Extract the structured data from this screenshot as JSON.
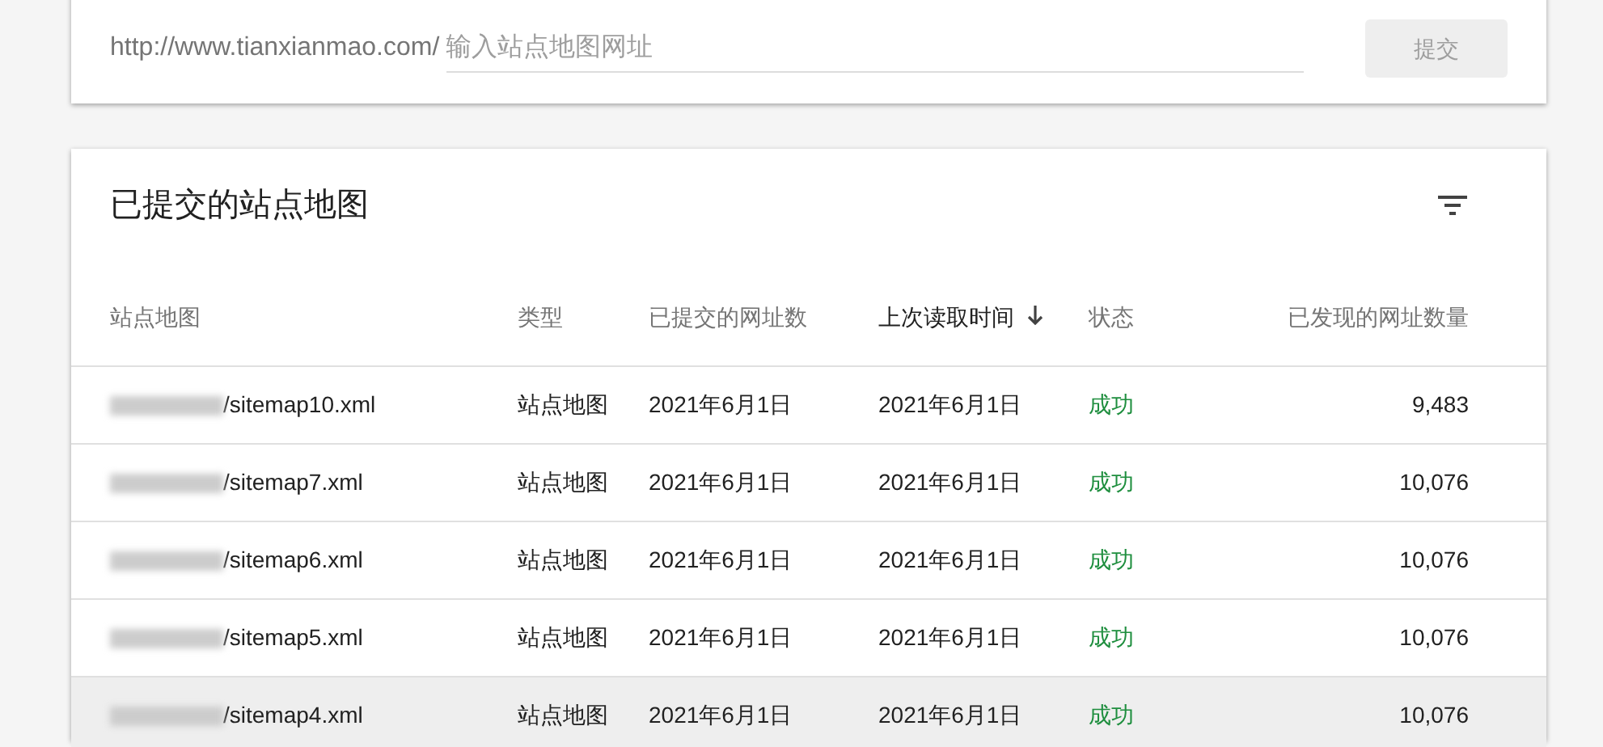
{
  "submit_form": {
    "url_prefix": "http://www.tianxianmao.com/",
    "placeholder": "输入站点地图网址",
    "button": "提交",
    "button_disabled": true
  },
  "sitemaps_card": {
    "title": "已提交的站点地图",
    "table": {
      "columns": [
        {
          "label": "站点地图",
          "sorted": false
        },
        {
          "label": "类型",
          "sorted": false
        },
        {
          "label": "已提交的网址数",
          "sorted": false
        },
        {
          "label": "上次读取时间",
          "sorted": true
        },
        {
          "label": "状态",
          "sorted": false
        },
        {
          "label": "已发现的网址数量",
          "sorted": false
        }
      ],
      "rows": [
        {
          "sitemap": "/sitemap10.xml",
          "type": "站点地图",
          "submitted": "2021年6月1日",
          "last_read": "2021年6月1日",
          "status": "成功",
          "discovered": "9,483",
          "highlighted": false
        },
        {
          "sitemap": "/sitemap7.xml",
          "type": "站点地图",
          "submitted": "2021年6月1日",
          "last_read": "2021年6月1日",
          "status": "成功",
          "discovered": "10,076",
          "highlighted": false
        },
        {
          "sitemap": "/sitemap6.xml",
          "type": "站点地图",
          "submitted": "2021年6月1日",
          "last_read": "2021年6月1日",
          "status": "成功",
          "discovered": "10,076",
          "highlighted": false
        },
        {
          "sitemap": "/sitemap5.xml",
          "type": "站点地图",
          "submitted": "2021年6月1日",
          "last_read": "2021年6月1日",
          "status": "成功",
          "discovered": "10,076",
          "highlighted": false
        },
        {
          "sitemap": "/sitemap4.xml",
          "type": "站点地图",
          "submitted": "2021年6月1日",
          "last_read": "2021年6月1日",
          "status": "成功",
          "discovered": "10,076",
          "highlighted": true
        }
      ]
    }
  }
}
